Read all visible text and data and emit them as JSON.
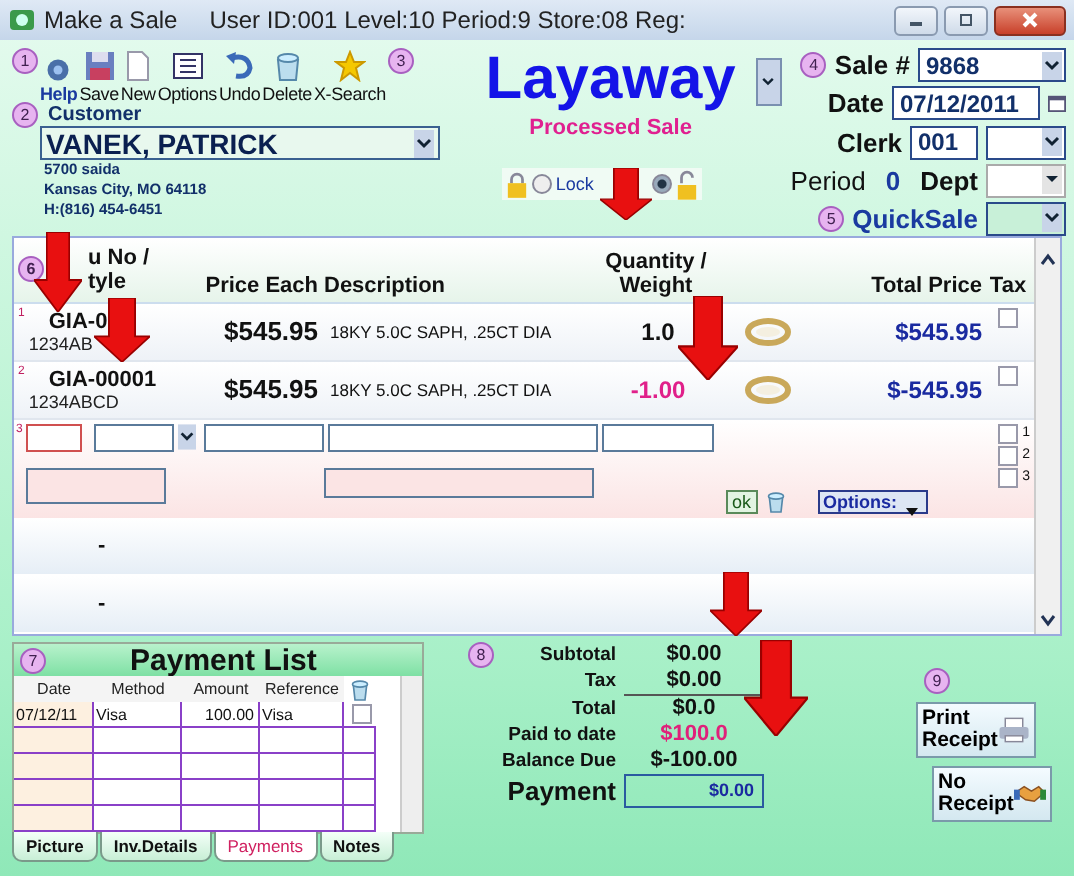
{
  "window": {
    "title": "Make a Sale",
    "info": "User ID:001 Level:10 Period:9 Store:08 Reg:"
  },
  "toolbar": {
    "badge": "1",
    "end_badge": "3",
    "buttons": [
      {
        "label": "Help",
        "kind": "help"
      },
      {
        "label": "Save",
        "kind": "save"
      },
      {
        "label": "New",
        "kind": "new"
      },
      {
        "label": "Options",
        "kind": "options"
      },
      {
        "label": "Undo",
        "kind": "undo"
      },
      {
        "label": "Delete",
        "kind": "delete"
      },
      {
        "label": "X-Search",
        "kind": "star"
      }
    ]
  },
  "mode": {
    "title": "Layaway",
    "subtitle": "Processed Sale"
  },
  "customer": {
    "badge": "2",
    "label": "Customer",
    "name": "VANEK, PATRICK",
    "address": [
      "5700 saida",
      "Kansas City, MO  64118",
      "H:(816) 454-6451"
    ]
  },
  "lock": {
    "label": "Lock",
    "locked": false
  },
  "sale": {
    "badge": "4",
    "sale_label": "Sale #",
    "sale_no": "9868",
    "date_label": "Date",
    "date": "07/12/2011",
    "clerk_label": "Clerk",
    "clerk": "001",
    "period_label": "Period",
    "period": "0",
    "dept_label": "Dept",
    "quick_badge": "5",
    "quick_label": "QuickSale"
  },
  "items": {
    "badge": "6",
    "columns": [
      {
        "lines": [
          "u No /",
          "tyle"
        ]
      },
      {
        "lines": [
          "Price Each"
        ]
      },
      {
        "lines": [
          "Description"
        ]
      },
      {
        "lines": [
          "Quantity /",
          "Weight"
        ]
      },
      {
        "lines": [
          "Total Price"
        ]
      },
      {
        "lines": [
          "Tax"
        ]
      }
    ],
    "rows": [
      {
        "index": "1",
        "sku": "GIA-0",
        "code": "1234AB",
        "price": "$545.95",
        "description": "18KY 5.0C SAPH, .25CT DIA",
        "quantity": "1.0",
        "negative": false,
        "total": "$545.95",
        "tax": false
      },
      {
        "index": "2",
        "sku": "GIA-00001",
        "code": "1234ABCD",
        "price": "$545.95",
        "description": "18KY 5.0C SAPH, .25CT DIA",
        "quantity": "-1.00",
        "negative": true,
        "total": "$-545.95",
        "tax": false
      }
    ],
    "entry": {
      "index": "3",
      "ok": "ok",
      "options": "Options:",
      "checks": [
        {
          "label": "1",
          "checked": false
        },
        {
          "label": "2",
          "checked": false
        },
        {
          "label": "3",
          "checked": false
        }
      ]
    },
    "empty_rows": [
      "-",
      "-"
    ]
  },
  "payments": {
    "badge": "7",
    "title": "Payment List",
    "columns": [
      "Date",
      "Method",
      "Amount",
      "Reference"
    ],
    "rows": [
      {
        "cells": [
          "07/12/11",
          "Visa",
          "100.00",
          "Visa"
        ],
        "checked": false
      }
    ],
    "tabs": [
      {
        "label": "Picture",
        "selected": false
      },
      {
        "label": "Inv.Details",
        "selected": false
      },
      {
        "label": "Payments",
        "selected": true
      },
      {
        "label": "Notes",
        "selected": false
      }
    ]
  },
  "totals": {
    "badge": "8",
    "lines": [
      {
        "label": "Subtotal",
        "value": "$0.00",
        "highlight": false
      },
      {
        "label": "Tax",
        "value": "$0.00",
        "highlight": false
      },
      {
        "label": "Total",
        "value": "$0.0",
        "highlight": false
      },
      {
        "label": "Paid to date",
        "value": "$100.0",
        "highlight": true
      },
      {
        "label": "Balance Due",
        "value": "$-100.00",
        "highlight": false
      }
    ],
    "payment_label": "Payment",
    "payment": "$0.00"
  },
  "receipt": {
    "badge": "9",
    "buttons": [
      {
        "label": "Print Receipt",
        "kind": "print"
      },
      {
        "label": "No Receipt",
        "kind": "handshake"
      }
    ]
  }
}
